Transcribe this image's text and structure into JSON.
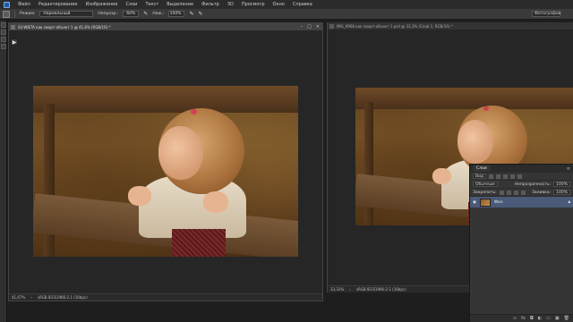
{
  "menu": {
    "items": [
      "Файл",
      "Редактирование",
      "Изображение",
      "Слои",
      "Текст",
      "Выделение",
      "Фильтр",
      "3D",
      "Просмотр",
      "Окно",
      "Справка"
    ]
  },
  "options": {
    "mode_label": "Режим:",
    "mode_value": "Нормальный",
    "opacity_label": "Непрозр.:",
    "opacity_value": "60%",
    "flow_label": "Наж.:",
    "flow_value": "100%",
    "workspace": "Фотография"
  },
  "doc1": {
    "title": "03-WIETA как смарт-объект 1 @ 41,6% (RGB/16) *",
    "zoom": "41,67%",
    "profile": "sRGB IEC61966-2.1 (16bpc)"
  },
  "doc2": {
    "title": "IMG_9968 как смарт-объект 1.psd @ 33,3% (Слой 1, RGB/16) *",
    "zoom": "33,33%",
    "profile": "sRGB IEC61966-2.1 (16bpc)"
  },
  "layers": {
    "tab": "Слои",
    "kind": "Вид",
    "blend": "Обычные",
    "opacity_label": "Непрозрачность:",
    "opacity_value": "100%",
    "lock_label": "Закрепить:",
    "fill_label": "Заливка:",
    "fill_value": "100%",
    "layer_name": "Фон"
  }
}
